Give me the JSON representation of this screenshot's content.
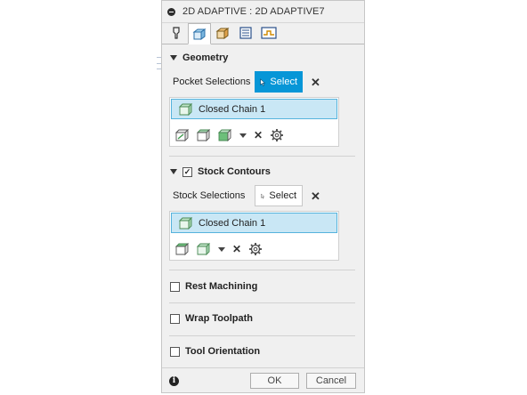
{
  "window": {
    "title": "2D ADAPTIVE : 2D ADAPTIVE7"
  },
  "tabs": [
    {
      "icon": "tool-icon"
    },
    {
      "icon": "geometry-icon"
    },
    {
      "icon": "heights-icon"
    },
    {
      "icon": "passes-icon"
    },
    {
      "icon": "linking-icon"
    }
  ],
  "geometry": {
    "heading": "Geometry",
    "pocket_label": "Pocket Selections",
    "select_label": "Select",
    "chain_label": "Closed Chain 1"
  },
  "stock": {
    "heading": "Stock Contours",
    "checked": true,
    "check_mark": "✓",
    "stock_label": "Stock Selections",
    "select_label": "Select",
    "chain_label": "Closed Chain 1"
  },
  "options": {
    "rest_machining": "Rest Machining",
    "wrap_toolpath": "Wrap Toolpath",
    "tool_orientation": "Tool Orientation"
  },
  "footer": {
    "info": "i",
    "ok": "OK",
    "cancel": "Cancel"
  },
  "colors": {
    "accent": "#0696d7",
    "selection_fill": "#c9e7f5",
    "selection_border": "#55b3dc"
  }
}
